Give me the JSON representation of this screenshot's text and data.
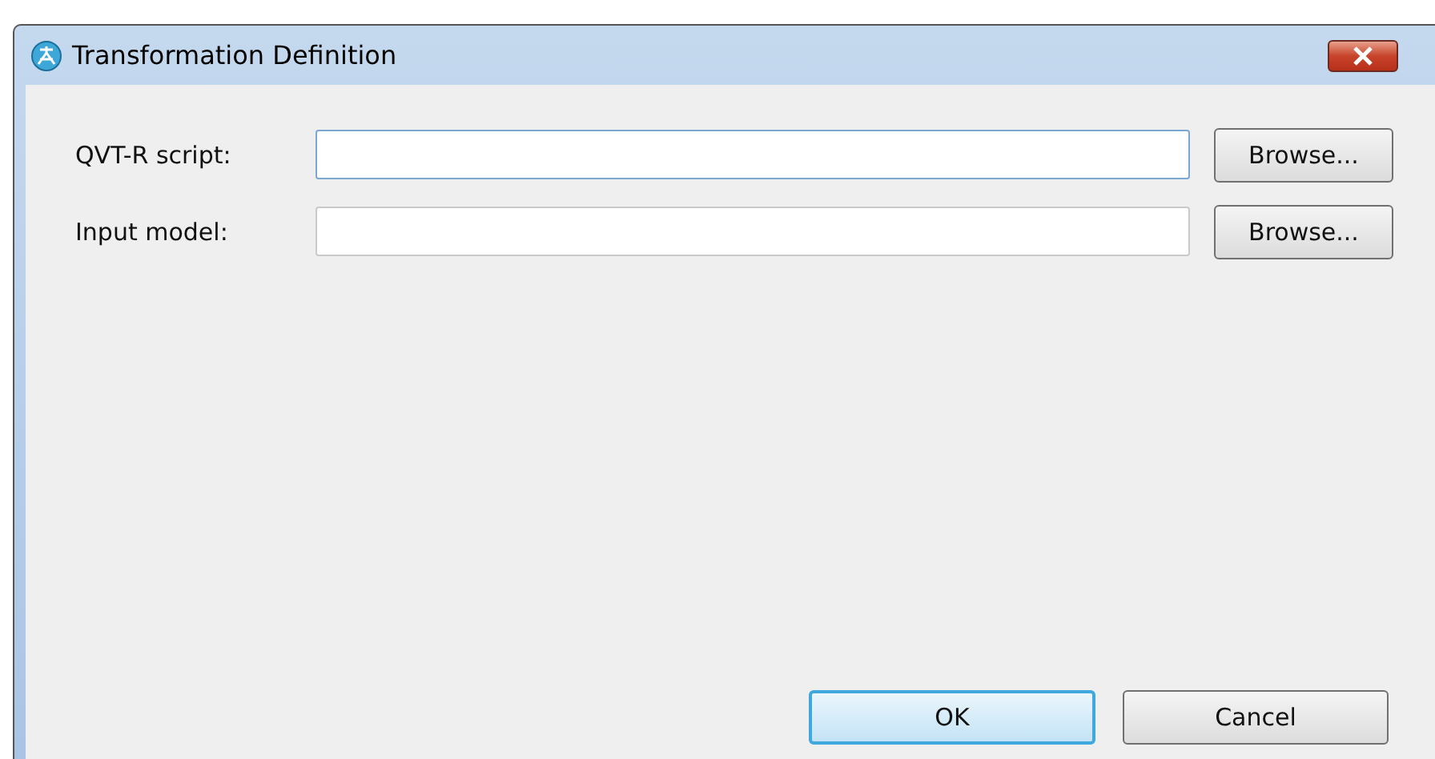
{
  "window": {
    "title": "Transformation Definition"
  },
  "fields": [
    {
      "label": "QVT-R script:",
      "focused": true,
      "button": "Browse..."
    },
    {
      "label": "Input model:",
      "focused": false,
      "button": "Browse..."
    }
  ],
  "buttons": [
    {
      "label": "OK",
      "default": true
    },
    {
      "label": "Cancel",
      "default": false
    }
  ]
}
